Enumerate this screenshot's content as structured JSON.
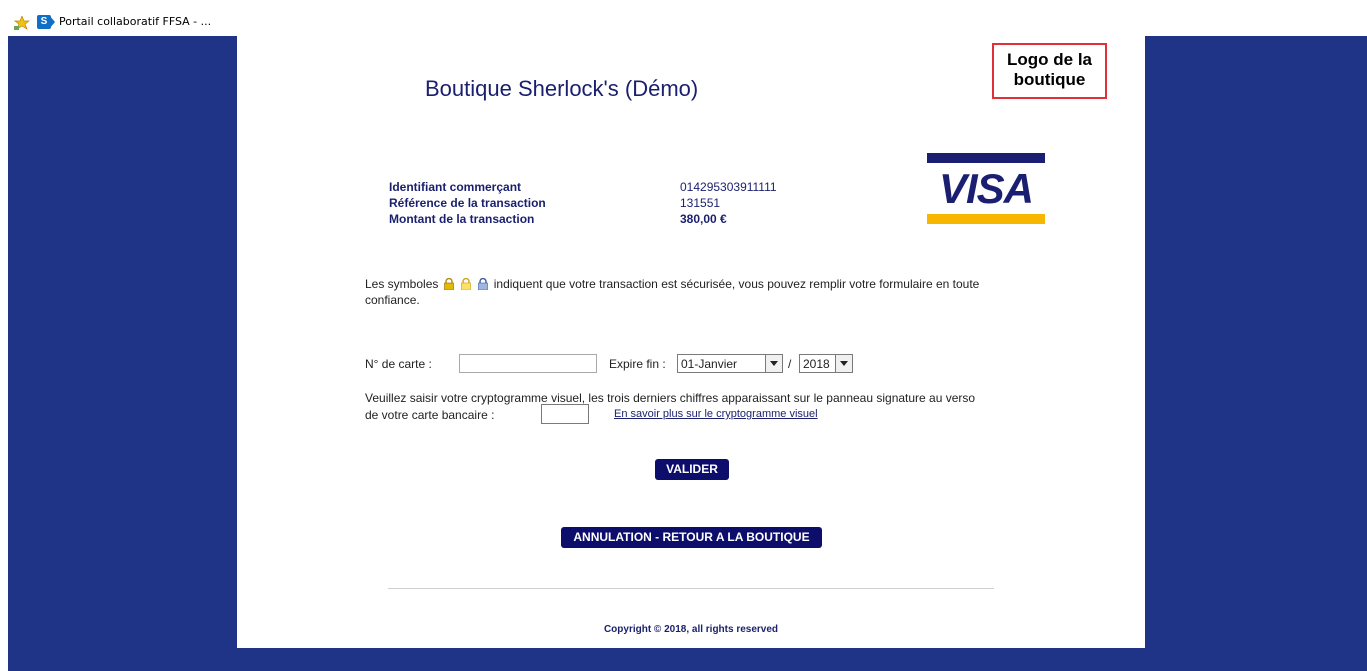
{
  "favorites_bar": {
    "item_label": "Portail collaboratif FFSA - ..."
  },
  "shop": {
    "title": "Boutique Sherlock's (Démo)",
    "logo_text": "Logo de la boutique"
  },
  "transaction": {
    "labels": [
      "Identifiant commerçant",
      "Référence de la transaction",
      "Montant de la transaction"
    ],
    "merchant_id": "014295303911111",
    "reference": "131551",
    "amount": "380,00 €"
  },
  "card_brand": "VISA",
  "security": {
    "text_before": "Les symboles",
    "text_after": "indiquent que votre transaction est sécurisée, vous pouvez remplir votre formulaire en toute confiance."
  },
  "form": {
    "card_number_label": "N° de carte :",
    "card_number_value": "",
    "expiry_label": "Expire fin :",
    "month_selected": "01-Janvier",
    "separator": "/",
    "year_selected": "2018",
    "cvv_text": "Veuillez saisir votre cryptogramme visuel, les trois derniers chiffres apparaissant sur le panneau signature au verso",
    "cvv_label": "de votre carte bancaire :",
    "cvv_value": "",
    "cvv_help_link": "En savoir plus sur le cryptogramme visuel"
  },
  "buttons": {
    "validate": "VALIDER",
    "cancel": "ANNULATION - RETOUR A LA BOUTIQUE"
  },
  "footer": {
    "copyright": "Copyright © 2018, all rights reserved"
  },
  "colors": {
    "page_bg": "#1f3387",
    "text_navy": "#1a1f6e",
    "button_bg": "#0d0d6b",
    "visa_blue": "#1a1f71",
    "visa_gold": "#f7b600",
    "logo_border": "#e0303a"
  }
}
